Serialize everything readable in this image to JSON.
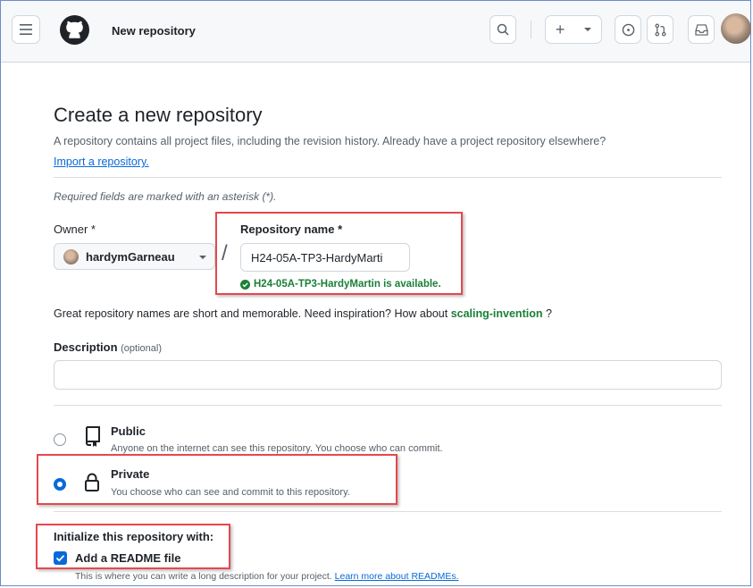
{
  "header": {
    "title": "New repository",
    "menu_icon": "hamburger-icon",
    "logo": "github-logo",
    "search_icon": "search-icon",
    "create_label": "+",
    "issues_icon": "issues-icon",
    "pulls_icon": "pull-request-icon",
    "inbox_icon": "inbox-icon"
  },
  "page": {
    "heading": "Create a new repository",
    "intro": "A repository contains all project files, including the revision history. Already have a project repository elsewhere?",
    "import_link": "Import a repository.",
    "required_note": "Required fields are marked with an asterisk (*)."
  },
  "owner": {
    "label": "Owner *",
    "value": "hardymGarneau"
  },
  "repo": {
    "label": "Repository name *",
    "value": "H24-05A-TP3-HardyMarti",
    "availability": "H24-05A-TP3-HardyMartin is available.",
    "separator": "/"
  },
  "suggestion": {
    "text": "Great repository names are short and memorable. Need inspiration? How about",
    "name": "scaling-invention",
    "end": "?"
  },
  "description": {
    "label": "Description",
    "optional": "(optional)",
    "value": ""
  },
  "visibility": {
    "public_title": "Public",
    "public_desc": "Anyone on the internet can see this repository. You choose who can commit.",
    "private_title": "Private",
    "private_desc": "You choose who can see and commit to this repository.",
    "selected": "Private"
  },
  "init": {
    "heading": "Initialize this repository with:",
    "readme_label": "Add a README file",
    "readme_checked": true,
    "readme_desc": "This is where you can write a long description for your project.",
    "readme_link": "Learn more about READMEs."
  },
  "colors": {
    "accent": "#0969da",
    "success": "#1a7f37",
    "highlight": "#e5484d"
  }
}
